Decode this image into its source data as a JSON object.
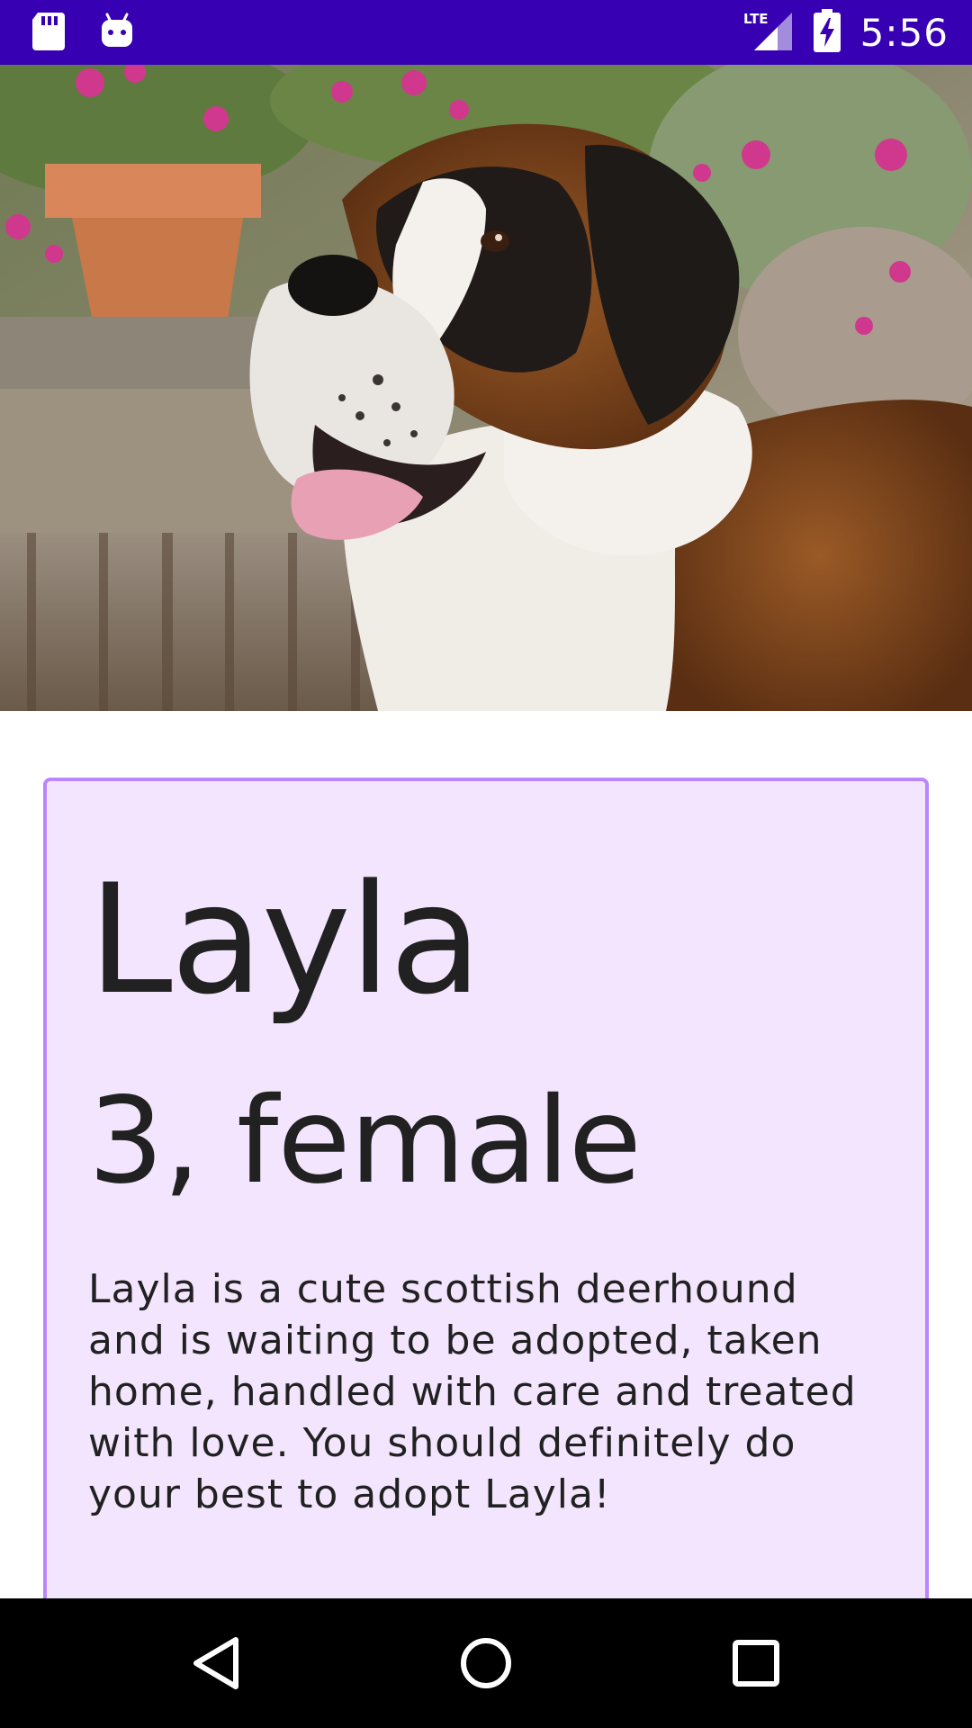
{
  "status_bar": {
    "time": "5:56",
    "network": "LTE",
    "left_icons": [
      "sd-card-icon",
      "android-icon"
    ],
    "right_icons": [
      "lte-signal-icon",
      "battery-charging-icon"
    ],
    "background": "#3700b3"
  },
  "hero": {
    "icon": "dog-photo"
  },
  "pet": {
    "name": "Layla",
    "age_gender": "3, female",
    "description": "Layla is a cute scottish deerhound and is waiting to be adopted, taken home, handled with care and treated with love. You should definitely do your best to adopt Layla!"
  },
  "colors": {
    "card_background": "#f3e5fd",
    "card_border": "#bb86fc",
    "text": "#212121"
  },
  "nav_bar": {
    "buttons": [
      "back-icon",
      "home-icon",
      "recents-icon"
    ]
  }
}
